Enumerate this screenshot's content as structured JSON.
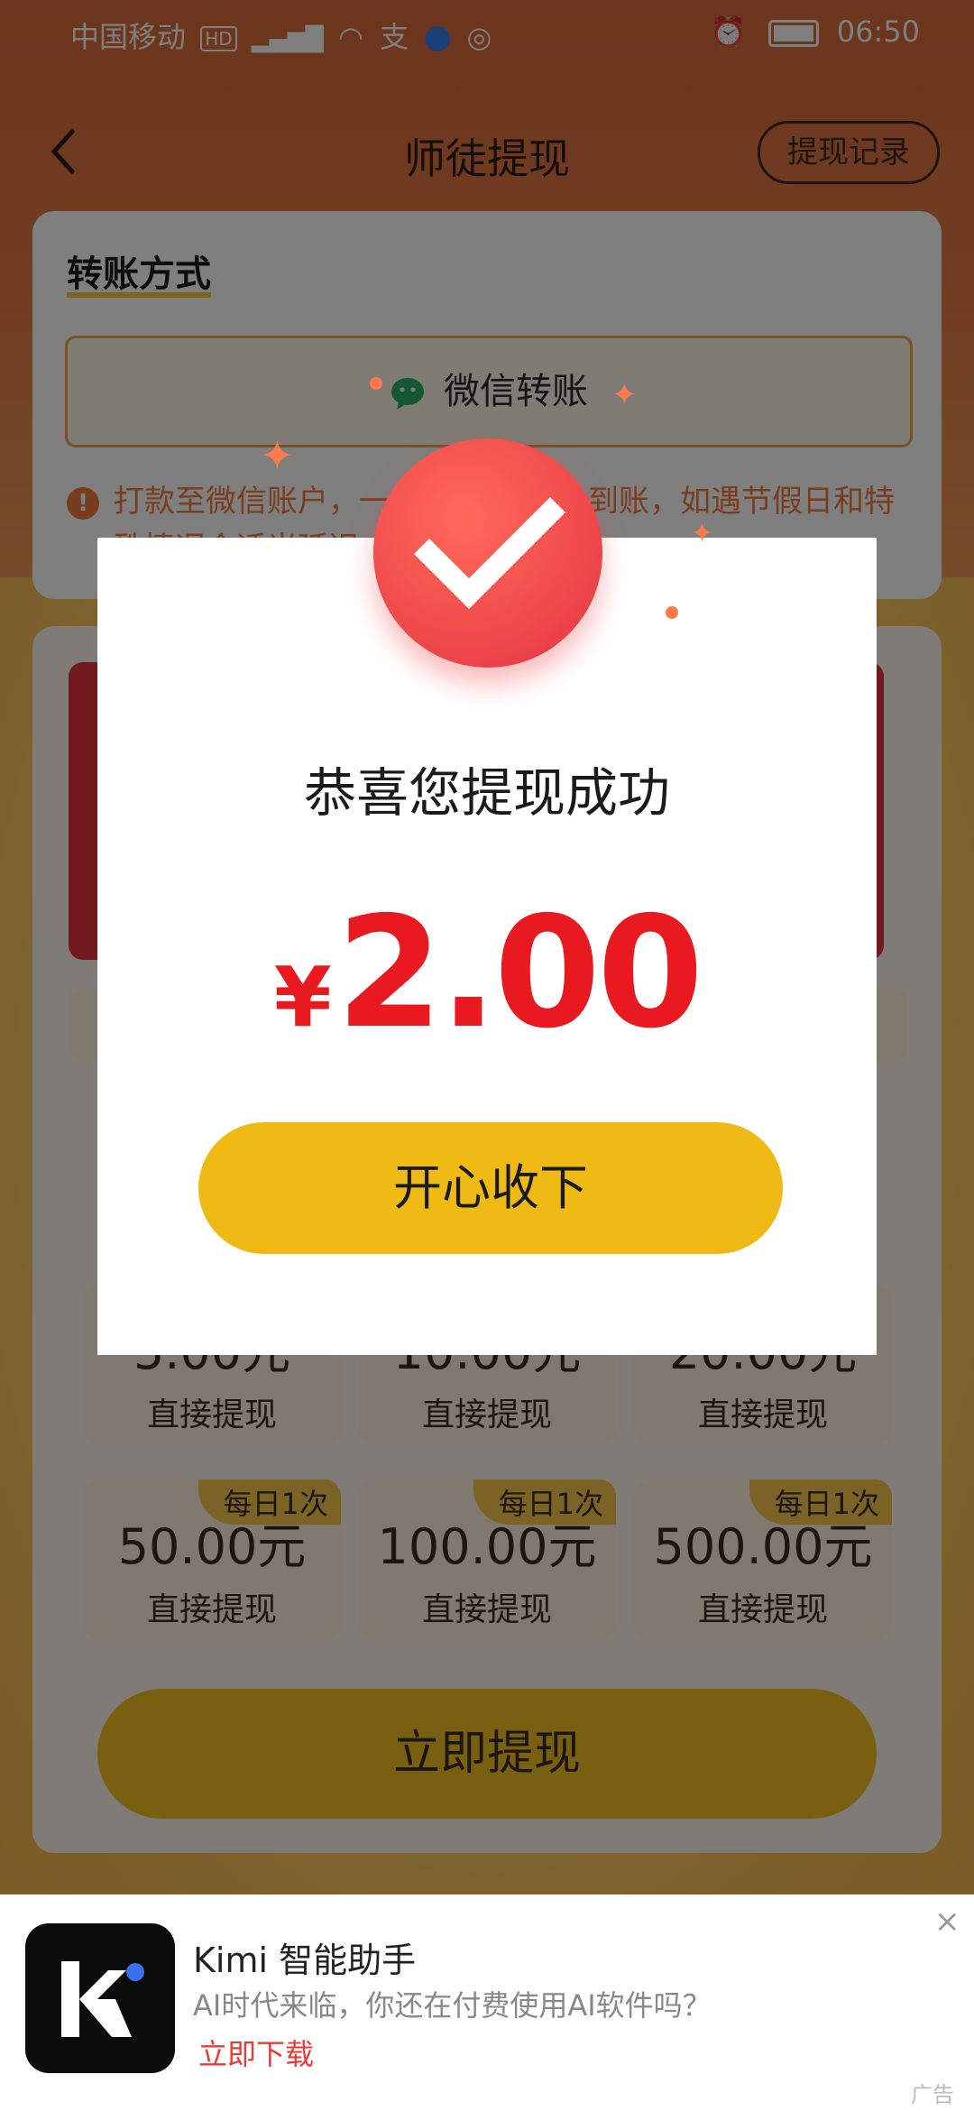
{
  "status_bar": {
    "carrier": "中国移动",
    "icons_left": [
      "hd-icon",
      "signal-4g-icon",
      "wifi-icon",
      "alipay-icon",
      "browser-icon",
      "nfc-icon"
    ],
    "alarm": "alarm-icon",
    "time": "06:50"
  },
  "nav": {
    "title": "师徒提现",
    "record_label": "提现记录"
  },
  "transfer": {
    "section_title": "转账方式",
    "method_label": "微信转账",
    "notice_prefix": "打款至微信账户，一",
    "notice_suffix": "到账，如遇节假日和特",
    "notice_line2": "殊情况会适当延迟"
  },
  "options": [
    {
      "amount": "5.00元",
      "label": "直接提现",
      "badge": ""
    },
    {
      "amount": "10.00元",
      "label": "直接提现",
      "badge": ""
    },
    {
      "amount": "20.00元",
      "label": "直接提现",
      "badge": ""
    },
    {
      "amount": "50.00元",
      "label": "直接提现",
      "badge": "每日1次"
    },
    {
      "amount": "100.00元",
      "label": "直接提现",
      "badge": "每日1次"
    },
    {
      "amount": "500.00元",
      "label": "直接提现",
      "badge": "每日1次"
    }
  ],
  "withdraw_button": "立即提现",
  "dialog": {
    "title": "恭喜您提现成功",
    "currency": "¥",
    "amount": "2.00",
    "accept_label": "开心收下"
  },
  "ad": {
    "title": "Kimi 智能助手",
    "subtitle": "AI时代来临，你还在付费使用AI软件吗？",
    "link": "立即下载",
    "tag": "广告",
    "close": "×"
  },
  "colors": {
    "accent_red": "#e8191f",
    "button_yellow": "#f0ba14",
    "header_orange": "#d86a3a"
  }
}
